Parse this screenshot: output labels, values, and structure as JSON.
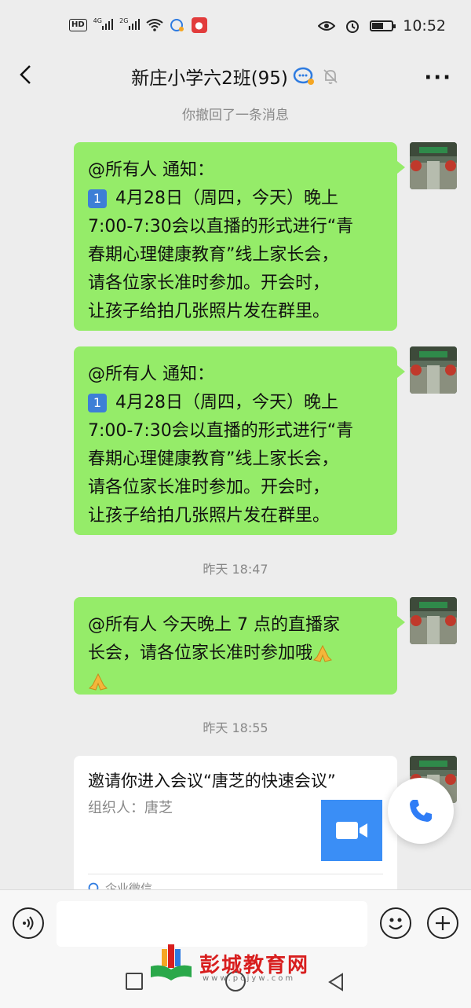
{
  "status_bar": {
    "hd": "HD",
    "net1": "4G",
    "net2": "2G",
    "time": "10:52"
  },
  "header": {
    "title": "新庄小学六2班(95)"
  },
  "messages": {
    "recalled": "你撤回了一条消息",
    "msg1_lines": [
      "@所有人 通知：",
      "4月28日（周四，今天）晚上",
      "7:00-7:30会以直播的形式进行“青",
      "春期心理健康教育”线上家长会，",
      "请各位家长准时参加。开会时，",
      "让孩子给拍几张照片发在群里。"
    ],
    "msg1_badge": "1",
    "msg2_lines": [
      "@所有人 通知：",
      "4月28日（周四，今天）晚上",
      "7:00-7:30会以直播的形式进行“青",
      "春期心理健康教育”线上家长会，",
      "请各位家长准时参加。开会时，",
      "让孩子给拍几张照片发在群里。"
    ],
    "msg2_badge": "1",
    "time1": "昨天 18:47",
    "msg3_line1": "@所有人  今天晚上 7 点的直播家",
    "msg3_line2": "长会，请各位家长准时参加哦",
    "time2": "昨天 18:55"
  },
  "meeting_card": {
    "title": "邀请你进入会议“唐芝的快速会议”",
    "organizer": "组织人：唐芝",
    "source": "企业微信"
  },
  "input_bar": {
    "placeholder": ""
  },
  "watermark": {
    "text": "彭城教育网",
    "sub": "www.pcjyw.com"
  },
  "colors": {
    "bubble": "#95ec69",
    "video_box": "#3a8ef6",
    "call_icon": "#2f7df6",
    "watermark": "#d81e1e"
  }
}
